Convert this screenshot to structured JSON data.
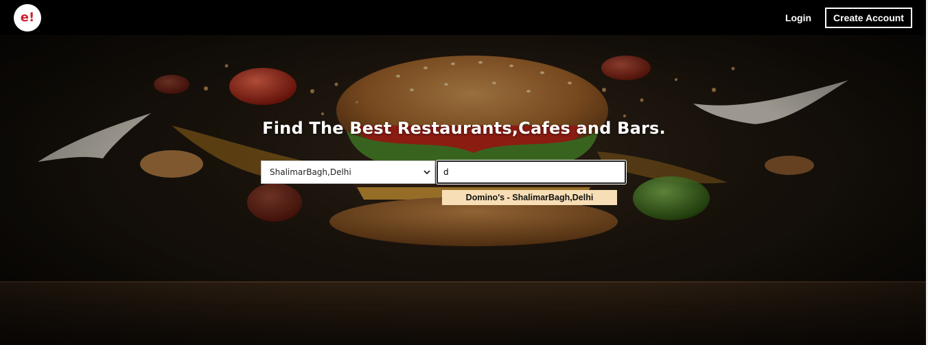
{
  "navbar": {
    "logo_text": "e!",
    "login_label": "Login",
    "create_account_label": "Create Account"
  },
  "hero": {
    "title": "Find The Best Restaurants,Cafes and Bars.",
    "location_select": {
      "selected": "ShalimarBagh,Delhi"
    },
    "search": {
      "value": "d"
    },
    "suggestions": [
      {
        "label": "Domino's - ShalimarBagh,Delhi"
      }
    ]
  },
  "icons": {
    "select_chevron": "chevron-down-icon"
  },
  "colors": {
    "navbar_bg": "#000000",
    "logo_text": "#cb202d",
    "suggestion_bg": "#f7deb6",
    "hero_text": "#ffffff"
  }
}
